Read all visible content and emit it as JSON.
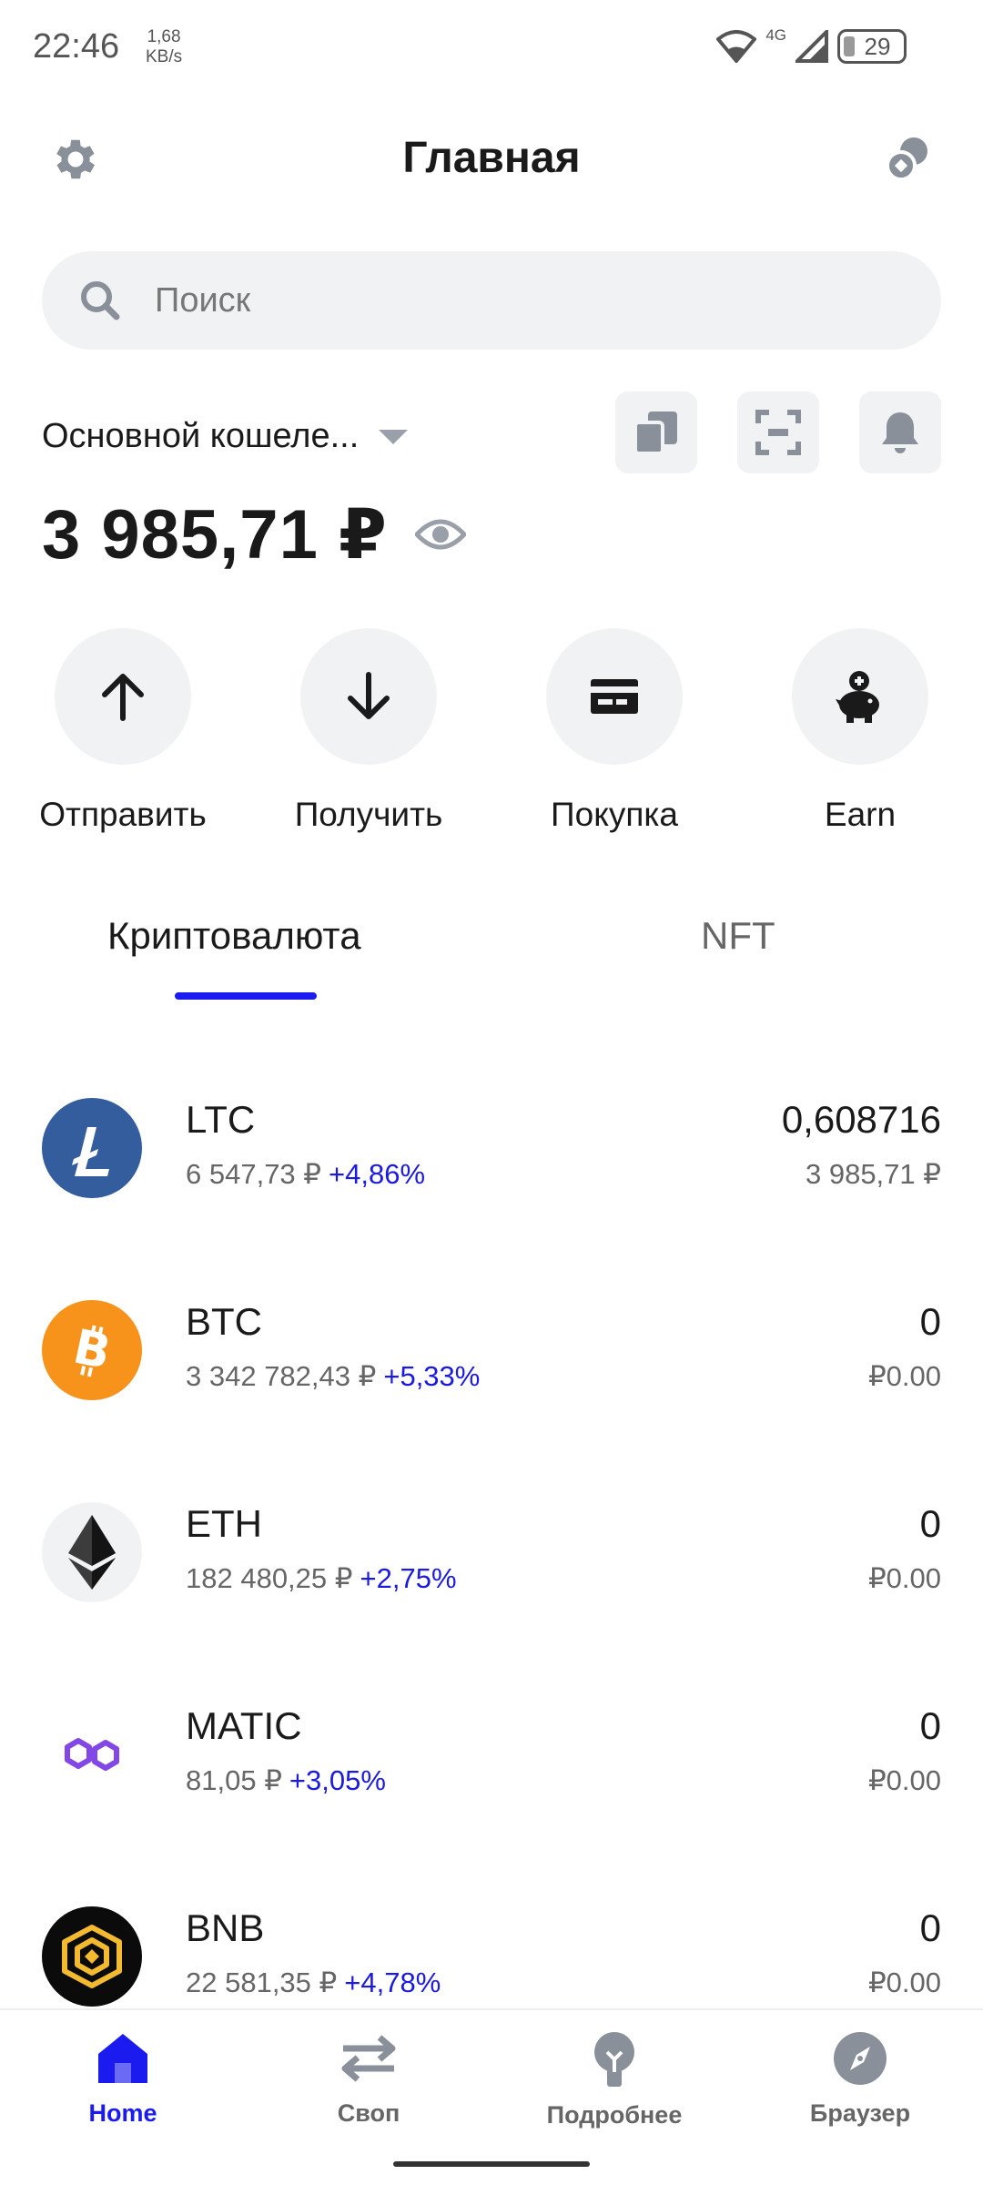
{
  "status_bar": {
    "time": "22:46",
    "speed_value": "1,68",
    "speed_unit": "KB/s",
    "network": "4G",
    "battery": "29"
  },
  "header": {
    "title": "Главная",
    "settings_icon": "gear-icon",
    "connect_icon": "dapp-connect-icon"
  },
  "search": {
    "placeholder": "Поиск"
  },
  "wallet": {
    "name": "Основной кошеле...",
    "balance": "3 985,71 ₽"
  },
  "actions": [
    {
      "label": "Отправить",
      "icon": "arrow-up-icon"
    },
    {
      "label": "Получить",
      "icon": "arrow-down-icon"
    },
    {
      "label": "Покупка",
      "icon": "card-icon"
    },
    {
      "label": "Earn",
      "icon": "piggy-bank-icon"
    }
  ],
  "tabs": [
    {
      "label": "Криптовалюта",
      "active": true
    },
    {
      "label": "NFT",
      "active": false
    }
  ],
  "assets": [
    {
      "symbol": "LTC",
      "price": "6 547,73 ₽",
      "change": "+4,86%",
      "amount": "0,608716",
      "fiat": "3 985,71 ₽",
      "color": "#345d9d"
    },
    {
      "symbol": "BTC",
      "price": "3 342 782,43 ₽",
      "change": "+5,33%",
      "amount": "0",
      "fiat": "₽0.00",
      "color": "#f7931a"
    },
    {
      "symbol": "ETH",
      "price": "182 480,25 ₽",
      "change": "+2,75%",
      "amount": "0",
      "fiat": "₽0.00",
      "color": "#f1f2f4"
    },
    {
      "symbol": "MATIC",
      "price": "81,05 ₽",
      "change": "+3,05%",
      "amount": "0",
      "fiat": "₽0.00",
      "color": "#8247e5"
    },
    {
      "symbol": "BNB",
      "price": "22 581,35 ₽",
      "change": "+4,78%",
      "amount": "0",
      "fiat": "₽0.00",
      "color": "#f3ba2f"
    }
  ],
  "bottom_nav": [
    {
      "label": "Home",
      "icon": "home-icon",
      "active": true
    },
    {
      "label": "Своп",
      "icon": "swap-icon",
      "active": false
    },
    {
      "label": "Подробнее",
      "icon": "bulb-icon",
      "active": false
    },
    {
      "label": "Браузер",
      "icon": "compass-icon",
      "active": false
    }
  ],
  "colors": {
    "accent": "#1b1bf0",
    "surface": "#f1f2f4",
    "text": "#1a1a1a",
    "muted": "#666666"
  }
}
